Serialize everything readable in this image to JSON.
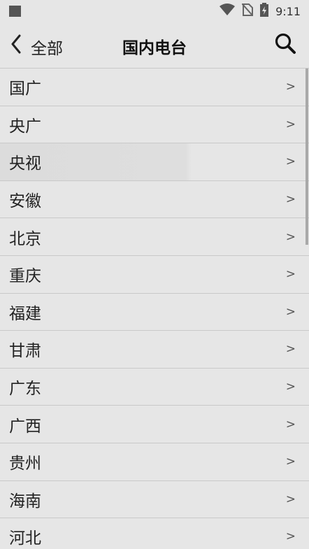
{
  "status_bar": {
    "time": "9:11"
  },
  "toolbar": {
    "back_label": "全部",
    "title": "国内电台"
  },
  "list": {
    "chevron": ">",
    "items": [
      {
        "label": "国广"
      },
      {
        "label": "央广"
      },
      {
        "label": "央视"
      },
      {
        "label": "安徽"
      },
      {
        "label": "北京"
      },
      {
        "label": "重庆"
      },
      {
        "label": "福建"
      },
      {
        "label": "甘肃"
      },
      {
        "label": "广东"
      },
      {
        "label": "广西"
      },
      {
        "label": "贵州"
      },
      {
        "label": "海南"
      },
      {
        "label": "河北"
      }
    ]
  },
  "icons": [
    "notification-square-icon",
    "wifi-icon",
    "no-sim-icon",
    "battery-charging-icon",
    "back-chevron-icon",
    "search-icon"
  ]
}
